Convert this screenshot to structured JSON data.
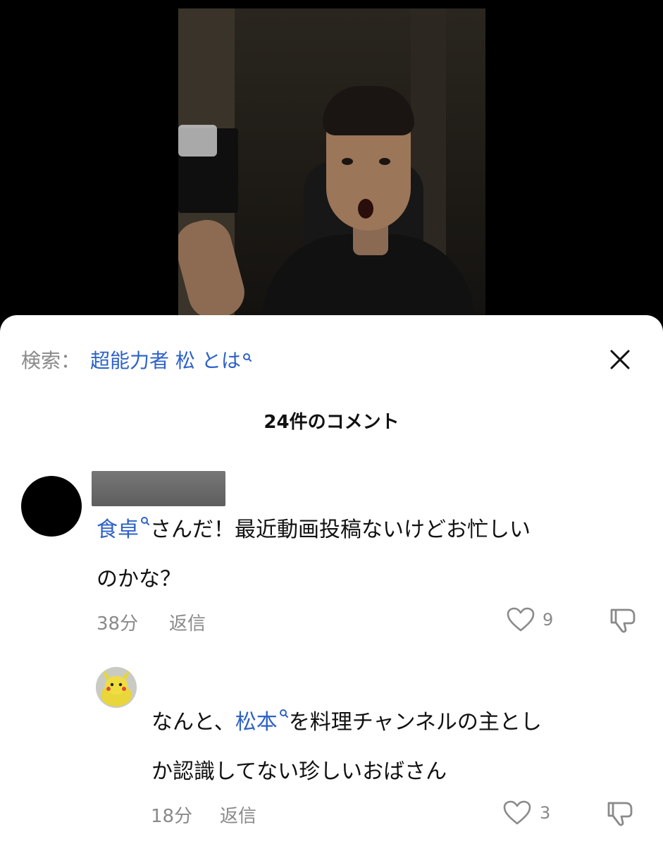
{
  "video": {},
  "search": {
    "prefix": "検索：",
    "term": "超能力者 松 とは"
  },
  "comments": {
    "count_label": "24件のコメント",
    "items": [
      {
        "link_text": "食卓",
        "text_line1": "さんだ！最近動画投稿ないけどお忙しい",
        "text_line2": "のかな？",
        "time": "38分",
        "reply_label": "返信",
        "likes": "9"
      },
      {
        "text_prefix": "なんと、",
        "link_text": "松本",
        "text_line1": "を料理チャンネルの主とし",
        "text_line2": "か認識してない珍しいおばさん",
        "time": "18分",
        "reply_label": "返信",
        "likes": "3"
      }
    ]
  },
  "colors": {
    "accent": "#2e62c7",
    "muted": "#8a8a8a"
  }
}
